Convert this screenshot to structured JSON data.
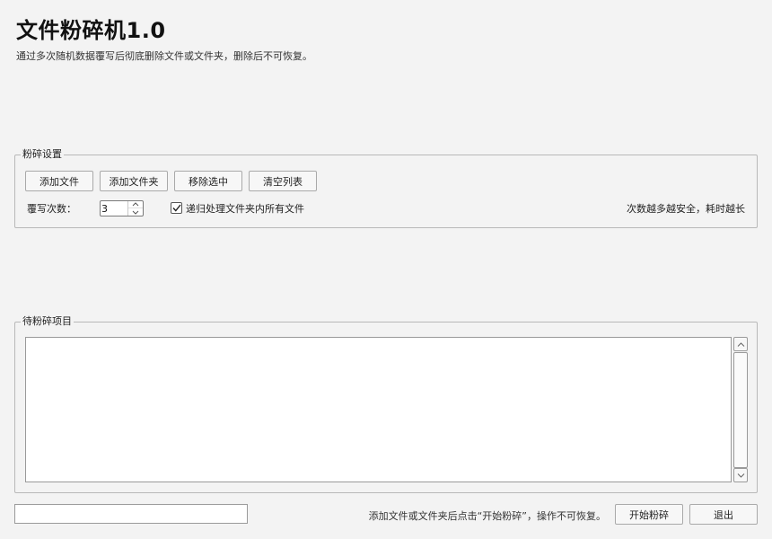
{
  "app": {
    "title": "文件粉碎机1.0",
    "subtitle": "通过多次随机数据覆写后彻底删除文件或文件夹，删除后不可恢复。"
  },
  "settings": {
    "group_title": "粉碎设置",
    "buttons": {
      "add_file": "添加文件",
      "add_folder": "添加文件夹",
      "remove_selected": "移除选中",
      "clear_list": "清空列表"
    },
    "overwrite_label": "覆写次数：",
    "overwrite_count": "3",
    "recursive_checked": true,
    "recursive_label": "递归处理文件夹内所有文件",
    "note": "次数越多越安全，耗时越长"
  },
  "items": {
    "group_title": "待粉碎项目",
    "list": []
  },
  "footer": {
    "status_value": "",
    "hint": "添加文件或文件夹后点击“开始粉碎”，操作不可恢复。",
    "start_button": "开始粉碎",
    "exit_button": "退出"
  },
  "icons": {
    "checkmark": "check-icon",
    "spin_up": "chevron-up-icon",
    "spin_down": "chevron-down-icon",
    "scroll_up": "chevron-up-icon",
    "scroll_down": "chevron-down-icon"
  }
}
